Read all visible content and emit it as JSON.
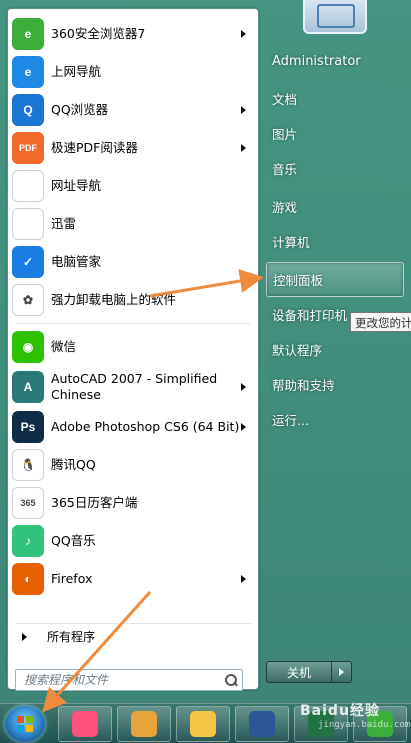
{
  "start_menu": {
    "programs": [
      {
        "label": "360安全浏览器7",
        "icon": "360-browser-icon",
        "color": "#3dae3a",
        "has_arrow": true,
        "glyph": "e"
      },
      {
        "label": "上网导航",
        "icon": "ie-icon",
        "color": "#1e88e5",
        "has_arrow": false,
        "glyph": "e"
      },
      {
        "label": "QQ浏览器",
        "icon": "qq-browser-icon",
        "color": "#1976d2",
        "has_arrow": true,
        "glyph": "Q"
      },
      {
        "label": "极速PDF阅读器",
        "icon": "pdf-reader-icon",
        "color": "#f06a2b",
        "has_arrow": true,
        "glyph": "PDF"
      },
      {
        "label": "网址导航",
        "icon": "file-icon",
        "color": "#ffffff",
        "has_arrow": false,
        "glyph": ""
      },
      {
        "label": "迅雷",
        "icon": "file-icon",
        "color": "#ffffff",
        "has_arrow": false,
        "glyph": ""
      },
      {
        "label": "电脑管家",
        "icon": "pc-manager-icon",
        "color": "#1a7de3",
        "has_arrow": false,
        "glyph": "✓"
      },
      {
        "label": "强力卸载电脑上的软件",
        "icon": "uninstaller-icon",
        "color": "#ffffff",
        "has_arrow": false,
        "glyph": "✿"
      }
    ],
    "recent": [
      {
        "label": "微信",
        "icon": "wechat-icon",
        "color": "#2dc100",
        "has_arrow": false,
        "glyph": "◉",
        "tall": false
      },
      {
        "label": "AutoCAD 2007 - Simplified\nChinese",
        "icon": "autocad-icon",
        "color": "#2b7a78",
        "has_arrow": true,
        "glyph": "A",
        "tall": true
      },
      {
        "label": "Adobe Photoshop CS6 (64 Bit)",
        "icon": "photoshop-icon",
        "color": "#0f2b46",
        "has_arrow": true,
        "glyph": "Ps",
        "tall": false
      },
      {
        "label": "腾讯QQ",
        "icon": "qq-penguin-icon",
        "color": "#ffffff",
        "has_arrow": false,
        "glyph": "🐧",
        "tall": false
      },
      {
        "label": "365日历客户端",
        "icon": "calendar-365-icon",
        "color": "#ffffff",
        "has_arrow": false,
        "glyph": "365",
        "tall": false
      },
      {
        "label": "QQ音乐",
        "icon": "qq-music-icon",
        "color": "#31c27c",
        "has_arrow": false,
        "glyph": "♪",
        "tall": false
      },
      {
        "label": "Firefox",
        "icon": "firefox-icon",
        "color": "#e66000",
        "has_arrow": true,
        "glyph": "◐",
        "tall": false
      }
    ],
    "all_programs": "所有程序",
    "search_placeholder": "搜索程序和文件",
    "right_items": [
      {
        "label": "Administrator",
        "name": "user-name",
        "highlight": false
      },
      {
        "label": "文档",
        "name": "documents",
        "highlight": false
      },
      {
        "label": "图片",
        "name": "pictures",
        "highlight": false
      },
      {
        "label": "音乐",
        "name": "music",
        "highlight": false
      },
      {
        "label": "游戏",
        "name": "games",
        "highlight": false
      },
      {
        "label": "计算机",
        "name": "computer",
        "highlight": false
      },
      {
        "label": "控制面板",
        "name": "control-panel",
        "highlight": true
      },
      {
        "label": "设备和打印机",
        "name": "devices-printers",
        "highlight": false
      },
      {
        "label": "默认程序",
        "name": "default-programs",
        "highlight": false
      },
      {
        "label": "帮助和支持",
        "name": "help-support",
        "highlight": false
      },
      {
        "label": "运行...",
        "name": "run",
        "highlight": false
      }
    ],
    "tooltip": "更改您的计",
    "shutdown_label": "关机"
  },
  "taskbar": {
    "items": [
      {
        "name": "taskbar-pinwheel-icon",
        "color": "#ff4f7b"
      },
      {
        "name": "taskbar-qq-browser-icon",
        "color": "#e8a33a"
      },
      {
        "name": "taskbar-explorer-icon",
        "color": "#f4c542"
      },
      {
        "name": "taskbar-word-icon",
        "color": "#2b579a"
      },
      {
        "name": "taskbar-excel-icon",
        "color": "#217346"
      },
      {
        "name": "taskbar-360-icon",
        "color": "#3dae3a"
      }
    ]
  },
  "watermark": "Baidu经验",
  "watermark_sub": "jingyan.baidu.com",
  "colors": {
    "annotation_arrow": "#f08a3c"
  }
}
